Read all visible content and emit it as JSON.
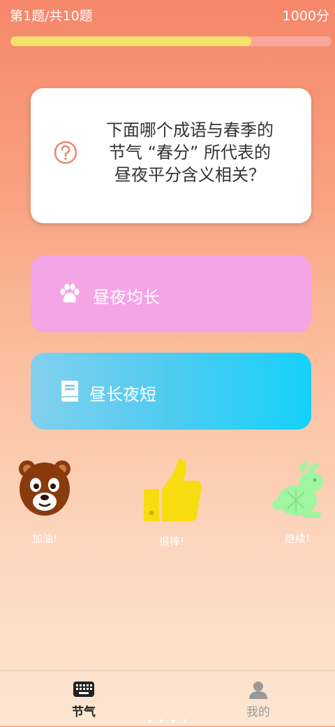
{
  "header": {
    "progress": "第1题/共10题",
    "score": "1000分",
    "progress_fraction": 0.75
  },
  "question": {
    "icon": "question-circle-icon",
    "text": "下面哪个成语与春季的\n节气 “春分” 所代表的\n昼夜平分含义相关？"
  },
  "options": [
    {
      "icon": "paw-icon",
      "label": "昼夜均长",
      "color": "#f4a5e6"
    },
    {
      "icon": "book-icon",
      "label": "昼长夜短",
      "color": "#15d1fa"
    }
  ],
  "mascots": [
    {
      "icon": "bear-icon",
      "label": "加油!",
      "color": "#8a3b0e"
    },
    {
      "icon": "thumbs-up-icon",
      "label": "很棒!",
      "color": "#f7dc10"
    },
    {
      "icon": "rabbit-icon",
      "label": "继续!",
      "color": "#9ff5a0"
    }
  ],
  "tabbar": {
    "tabs": [
      {
        "icon": "keyboard-icon",
        "label": "节气",
        "active": true
      },
      {
        "icon": "user-icon",
        "label": "我的",
        "active": false
      }
    ]
  }
}
